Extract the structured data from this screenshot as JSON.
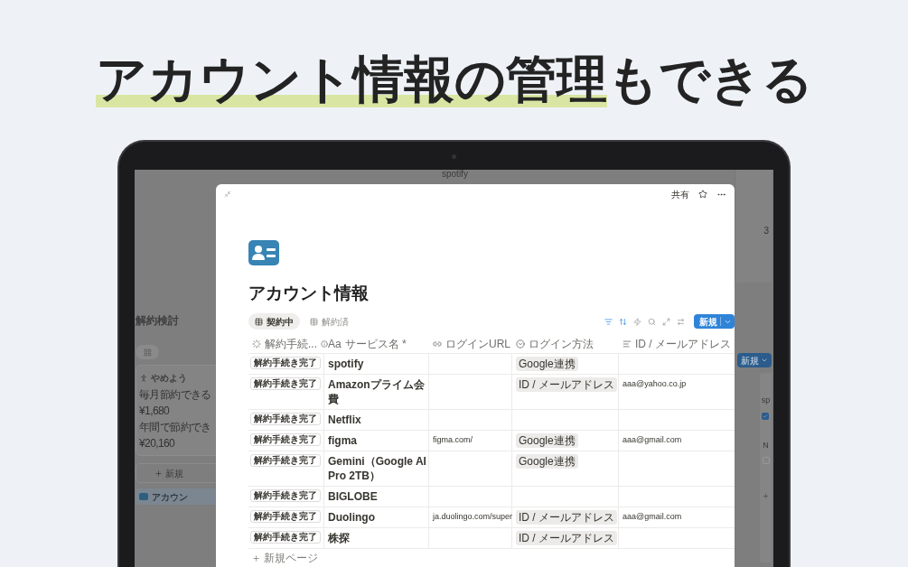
{
  "headline": [
    {
      "text": "アカウント情報の管理",
      "highlighted": true
    },
    {
      "text": "もできる",
      "highlighted": false
    }
  ],
  "background_page": {
    "top_text": "spotify",
    "count": "3",
    "section_title": "解約検討",
    "card": {
      "title": "やめよう",
      "lines": [
        "毎月節約できる",
        "¥1,680",
        "年間で節約でき",
        "¥20,160"
      ]
    },
    "add_label": "新規",
    "link": "アカウン",
    "right_button": "新規",
    "right_cards": [
      {
        "title": "sp",
        "checked": true
      },
      {
        "title": "N",
        "checked": false
      }
    ],
    "right_add": "+"
  },
  "modal": {
    "share": "共有",
    "title": "アカウント情報",
    "tabs": [
      {
        "label": "契約中",
        "selected": true
      },
      {
        "label": "解約済",
        "selected": false
      }
    ],
    "new_button": "新規",
    "columns": [
      {
        "label": "解約手続...",
        "kind": "status"
      },
      {
        "label": "サービス名 *",
        "kind": "title",
        "glyph": "Aa"
      },
      {
        "label": "ログインURL",
        "kind": "url"
      },
      {
        "label": "ログイン方法",
        "kind": "select"
      },
      {
        "label": "ID / メールアドレス",
        "kind": "text"
      }
    ],
    "rows": [
      {
        "status": "解約手続き完了",
        "service": "spotify",
        "login_method": "Google連携"
      },
      {
        "status": "解約手続き完了",
        "service": "Amazonプライム会費",
        "login_method": "ID / メールアドレス",
        "id": "aaa@yahoo.co.jp"
      },
      {
        "status": "解約手続き完了",
        "service": "Netflix"
      },
      {
        "status": "解約手続き完了",
        "service": "figma",
        "url": "figma.com/",
        "login_method": "Google連携",
        "id": "aaa@gmail.com"
      },
      {
        "status": "解約手続き完了",
        "service": "Gemini（Google AI Pro 2TB）",
        "login_method": "Google連携"
      },
      {
        "status": "解約手続き完了",
        "service": "BIGLOBE"
      },
      {
        "status": "解約手続き完了",
        "service": "Duolingo",
        "url": "ja.duolingo.com/super",
        "login_method": "ID / メールアドレス",
        "id": "aaa@gmail.com"
      },
      {
        "status": "解約手続き完了",
        "service": "株探",
        "login_method": "ID / メールアドレス"
      }
    ],
    "new_page": "新規ページ"
  }
}
